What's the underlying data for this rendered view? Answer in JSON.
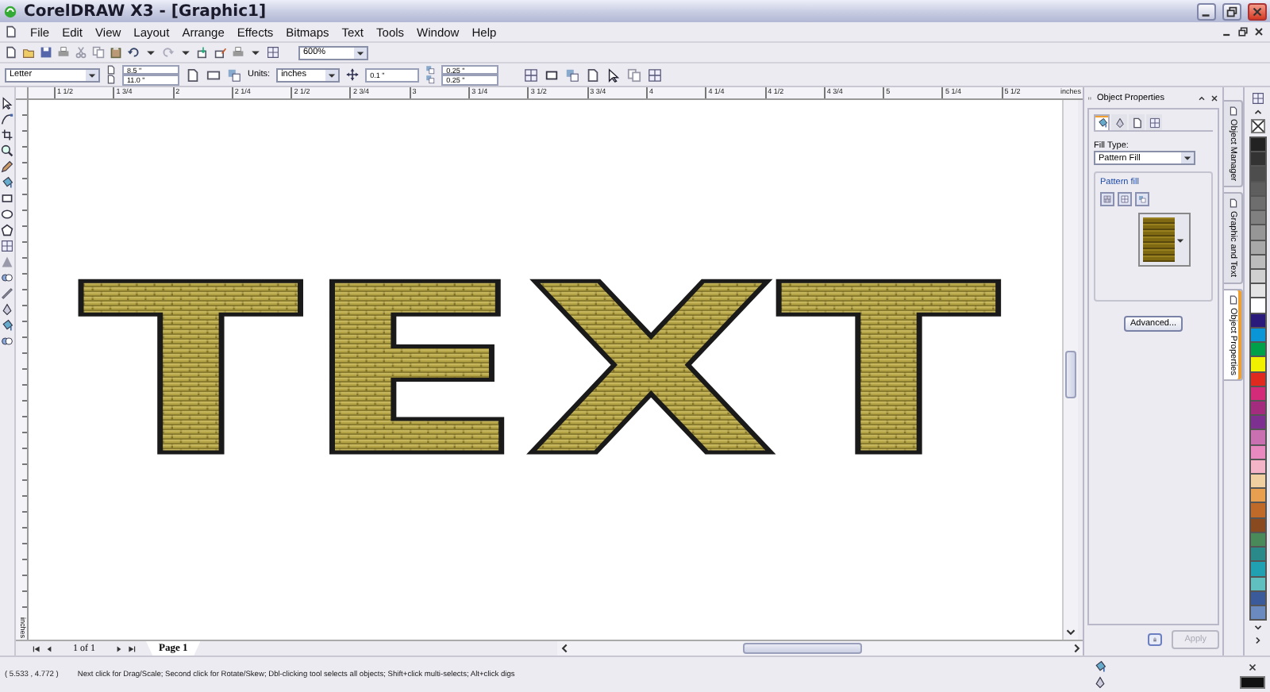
{
  "window": {
    "title": "CorelDRAW X3 - [Graphic1]"
  },
  "menu": [
    "File",
    "Edit",
    "View",
    "Layout",
    "Arrange",
    "Effects",
    "Bitmaps",
    "Text",
    "Tools",
    "Window",
    "Help"
  ],
  "toolbar": {
    "zoom": "600%"
  },
  "property_bar": {
    "paper": "Letter",
    "width": "8.5 \"",
    "height": "11.0 \"",
    "units_label": "Units:",
    "units": "inches",
    "nudge": "0.1 \"",
    "duplicate_x": "0.25 \"",
    "duplicate_y": "0.25 \""
  },
  "ruler": {
    "labels": [
      "1 1/2",
      "1 3/4",
      "2",
      "2 1/4",
      "2 1/2",
      "2 3/4",
      "3",
      "3 1/4",
      "3 1/2",
      "3 3/4",
      "4",
      "4 1/4",
      "4 1/2",
      "4 3/4",
      "5",
      "5 1/4",
      "5 1/2"
    ],
    "unit": "inches",
    "vertical_unit": "inches"
  },
  "canvas": {
    "artwork_text": "TEXT"
  },
  "page_nav": {
    "counter": "1 of 1",
    "tabs": [
      {
        "label": "Page 1",
        "selected": true
      }
    ]
  },
  "docker": {
    "title": "Object Properties",
    "property_tabs": [
      {
        "kind": "fill",
        "selected": true
      },
      {
        "kind": "outline",
        "selected": false
      },
      {
        "kind": "general",
        "selected": false
      },
      {
        "kind": "internet",
        "selected": false
      }
    ],
    "fill_type_label": "Fill Type:",
    "fill_type": "Pattern Fill",
    "group_label": "Pattern fill",
    "advanced_button": "Advanced...",
    "apply_button": {
      "label": "Apply",
      "disabled": true
    },
    "side_tabs": [
      {
        "label": "Object Manager",
        "selected": false
      },
      {
        "label": "Graphic and Text",
        "selected": false
      },
      {
        "label": "Object Properties",
        "selected": true
      }
    ]
  },
  "palette": [
    {
      "color": "#222222"
    },
    {
      "color": "#333333"
    },
    {
      "color": "#4d4d4d"
    },
    {
      "color": "#5e5e5e"
    },
    {
      "color": "#6e6e6e"
    },
    {
      "color": "#808080"
    },
    {
      "color": "#969696"
    },
    {
      "color": "#a8a8a8"
    },
    {
      "color": "#bcbcbc"
    },
    {
      "color": "#d0d0d0"
    },
    {
      "color": "#e4e4e4"
    },
    {
      "color": "#ffffff"
    },
    {
      "color": "#2a1a7a"
    },
    {
      "color": "#0a96d6"
    },
    {
      "color": "#00a04a"
    },
    {
      "color": "#f0f000"
    },
    {
      "color": "#e02a20"
    },
    {
      "color": "#d42a7a"
    },
    {
      "color": "#a32c7e"
    },
    {
      "color": "#7e3090"
    },
    {
      "color": "#c870b0"
    },
    {
      "color": "#e88ac0"
    },
    {
      "color": "#f4b4c8"
    },
    {
      "color": "#f0d0a0"
    },
    {
      "color": "#e8a050"
    },
    {
      "color": "#c06a2a"
    },
    {
      "color": "#8a4a20"
    },
    {
      "color": "#4a8a5a"
    },
    {
      "color": "#2a8a8a"
    },
    {
      "color": "#20a0b0"
    },
    {
      "color": "#60c0c0"
    },
    {
      "color": "#3a5a9a"
    },
    {
      "color": "#6a8ac0"
    }
  ],
  "status_bar": {
    "coordinates": "( 5.533 , 4.772 )",
    "hint": "Next click for Drag/Scale; Second click for Rotate/Skew; Dbl-clicking tool selects all objects; Shift+click multi-selects; Alt+click digs"
  }
}
